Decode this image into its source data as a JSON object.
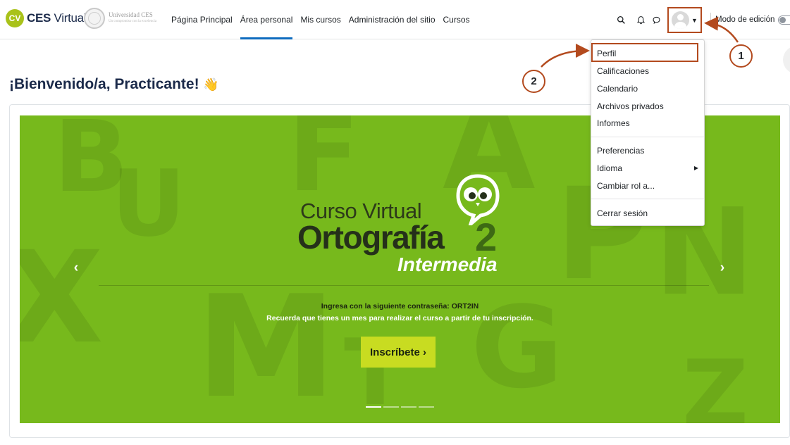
{
  "brand": {
    "badge": "CV",
    "name_bold": "CES",
    "name_light": "Virtual",
    "university": "Universidad CES",
    "university_tagline": "Un compromiso con la excelencia"
  },
  "nav": {
    "links": [
      {
        "label": "Página Principal",
        "active": false
      },
      {
        "label": "Área personal",
        "active": true
      },
      {
        "label": "Mis cursos",
        "active": false
      },
      {
        "label": "Administración del sitio",
        "active": false
      },
      {
        "label": "Cursos",
        "active": false
      }
    ],
    "edit_mode_label": "Modo de edición",
    "icons": [
      "search-icon",
      "bell-icon",
      "chat-icon"
    ]
  },
  "welcome": {
    "text": "¡Bienvenido/a, Practicante!",
    "emoji": "👋"
  },
  "user_menu": {
    "items": [
      {
        "label": "Perfil"
      },
      {
        "label": "Calificaciones"
      },
      {
        "label": "Calendario"
      },
      {
        "label": "Archivos privados"
      },
      {
        "label": "Informes"
      },
      {
        "label": "Preferencias"
      },
      {
        "label": "Idioma",
        "submenu": true
      },
      {
        "label": "Cambiar rol a..."
      },
      {
        "label": "Cerrar sesión"
      }
    ]
  },
  "carousel": {
    "curso_label": "Curso Virtual",
    "course_name": "Ortografía",
    "course_number": "2",
    "course_level": "Intermedia",
    "password_text": "Ingresa con la siguiente contraseña: ORT2IN",
    "reminder_text": "Recuerda que tienes un mes para realizar el curso a partir de tu inscripción.",
    "cta_label": "Inscríbete ›",
    "slide_count": 4,
    "active_slide": 1,
    "background_color": "#77b91c",
    "cta_color": "#c8dc21"
  },
  "annotations": {
    "step1": "1",
    "step2": "2",
    "color": "#b34a1e"
  }
}
